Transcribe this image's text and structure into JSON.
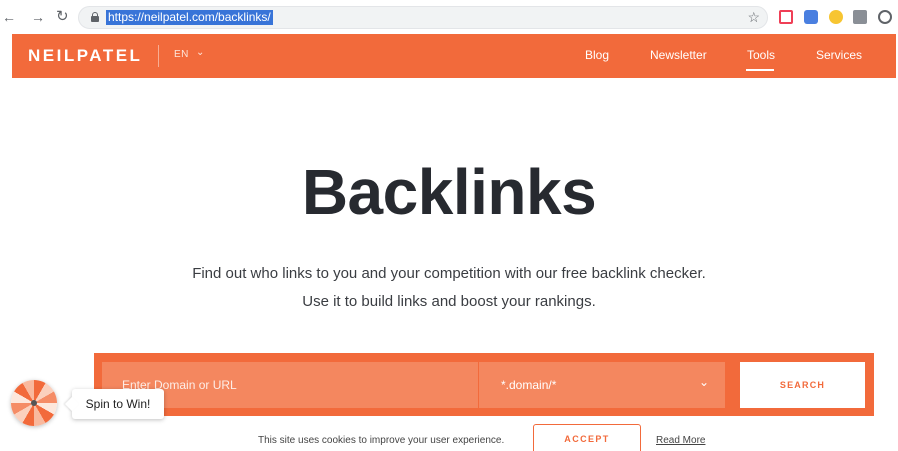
{
  "browser": {
    "url": "https://neilpatel.com/backlinks/",
    "back_icon": "back-arrow-icon",
    "forward_icon": "forward-arrow-icon",
    "reload_icon": "reload-icon",
    "extension_icons": [
      "pocket-icon",
      "extension-icon",
      "honey-icon",
      "code-icon",
      "settings-extension-icon"
    ]
  },
  "header": {
    "logo": "NEILPATEL",
    "language": "EN",
    "nav": [
      {
        "label": "Blog"
      },
      {
        "label": "Newsletter"
      },
      {
        "label": "Tools"
      },
      {
        "label": "Services"
      }
    ],
    "active_nav": "Tools",
    "accent_color": "#f26a3b"
  },
  "hero": {
    "title": "Backlinks",
    "line1": "Find out who links to you and your competition with our free backlink checker.",
    "line2": "Use it to build links and boost your rankings."
  },
  "search": {
    "placeholder": "Enter Domain or URL",
    "scope_value": "*.domain/*",
    "button_label": "SEARCH"
  },
  "spin": {
    "label": "Spin to Win!"
  },
  "cookie": {
    "text": "This site uses cookies to improve your user experience.",
    "accept_label": "ACCEPT",
    "read_more_label": "Read More"
  }
}
